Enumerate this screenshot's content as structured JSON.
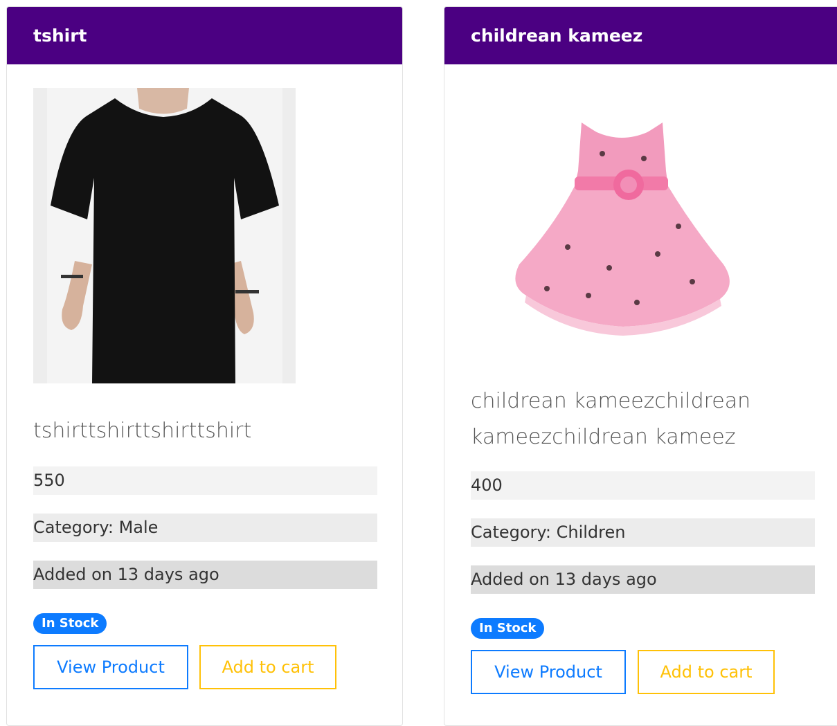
{
  "products": [
    {
      "title": "tshirt",
      "description": "tshirttshirttshirttshirt",
      "price": "550",
      "category": "Category: Male",
      "added": "Added on 13 days ago",
      "stock_badge": "In Stock",
      "view_label": "View Product",
      "cart_label": "Add to cart"
    },
    {
      "title": "childrean kameez",
      "description": "childrean kameezchildrean kameezchildrean kameez",
      "price": "400",
      "category": "Category: Children",
      "added": "Added on 13 days ago",
      "stock_badge": "In Stock",
      "view_label": "View Product",
      "cart_label": "Add to cart"
    }
  ],
  "colors": {
    "header_bg": "#4b0082",
    "badge_bg": "#0d7bff",
    "view_button": "#0d7bff",
    "cart_button": "#ffc107"
  }
}
